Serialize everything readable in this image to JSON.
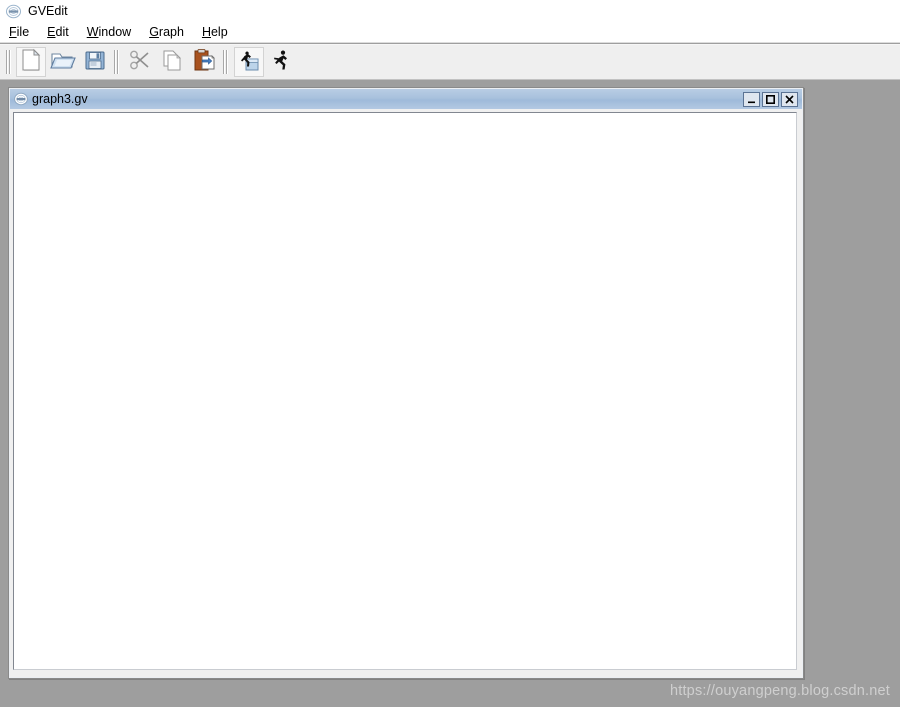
{
  "window": {
    "app_title": "GVEdit",
    "app_icon": "graphviz-logo-icon"
  },
  "menubar": {
    "items": [
      {
        "mnemonic": "F",
        "rest": "ile",
        "name": "menu-file"
      },
      {
        "mnemonic": "E",
        "rest": "dit",
        "name": "menu-edit"
      },
      {
        "mnemonic": "W",
        "rest": "indow",
        "name": "menu-window"
      },
      {
        "mnemonic": "G",
        "rest": "raph",
        "name": "menu-graph"
      },
      {
        "mnemonic": "H",
        "rest": "elp",
        "name": "menu-help"
      }
    ]
  },
  "toolbar": {
    "buttons": [
      {
        "icon": "new-file-icon",
        "label": "New",
        "enabled": true
      },
      {
        "icon": "open-folder-icon",
        "label": "Open",
        "enabled": true
      },
      {
        "icon": "save-floppy-icon",
        "label": "Save",
        "enabled": true
      },
      {
        "icon": "cut-scissors-icon",
        "label": "Cut",
        "enabled": false
      },
      {
        "icon": "copy-pages-icon",
        "label": "Copy",
        "enabled": false
      },
      {
        "icon": "paste-clipboard-icon",
        "label": "Paste",
        "enabled": true
      },
      {
        "icon": "run-settings-icon",
        "label": "Layout / Settings",
        "enabled": true
      },
      {
        "icon": "run-person-icon",
        "label": "Run",
        "enabled": true
      }
    ]
  },
  "child_window": {
    "title": "graph3.gv",
    "icon": "graphviz-logo-icon",
    "editor_text": "",
    "controls": {
      "minimize": "minimize-button",
      "maximize": "maximize-button",
      "close": "close-button"
    }
  },
  "watermark": {
    "text": "https://ouyangpeng.blog.csdn.net"
  },
  "colors": {
    "mdi_background": "#9e9e9e",
    "toolbar_background": "#efefef",
    "titlebar_active": "#a8c1dd",
    "editor_background": "#ffffff",
    "watermark_text": "#cfcfcf"
  }
}
